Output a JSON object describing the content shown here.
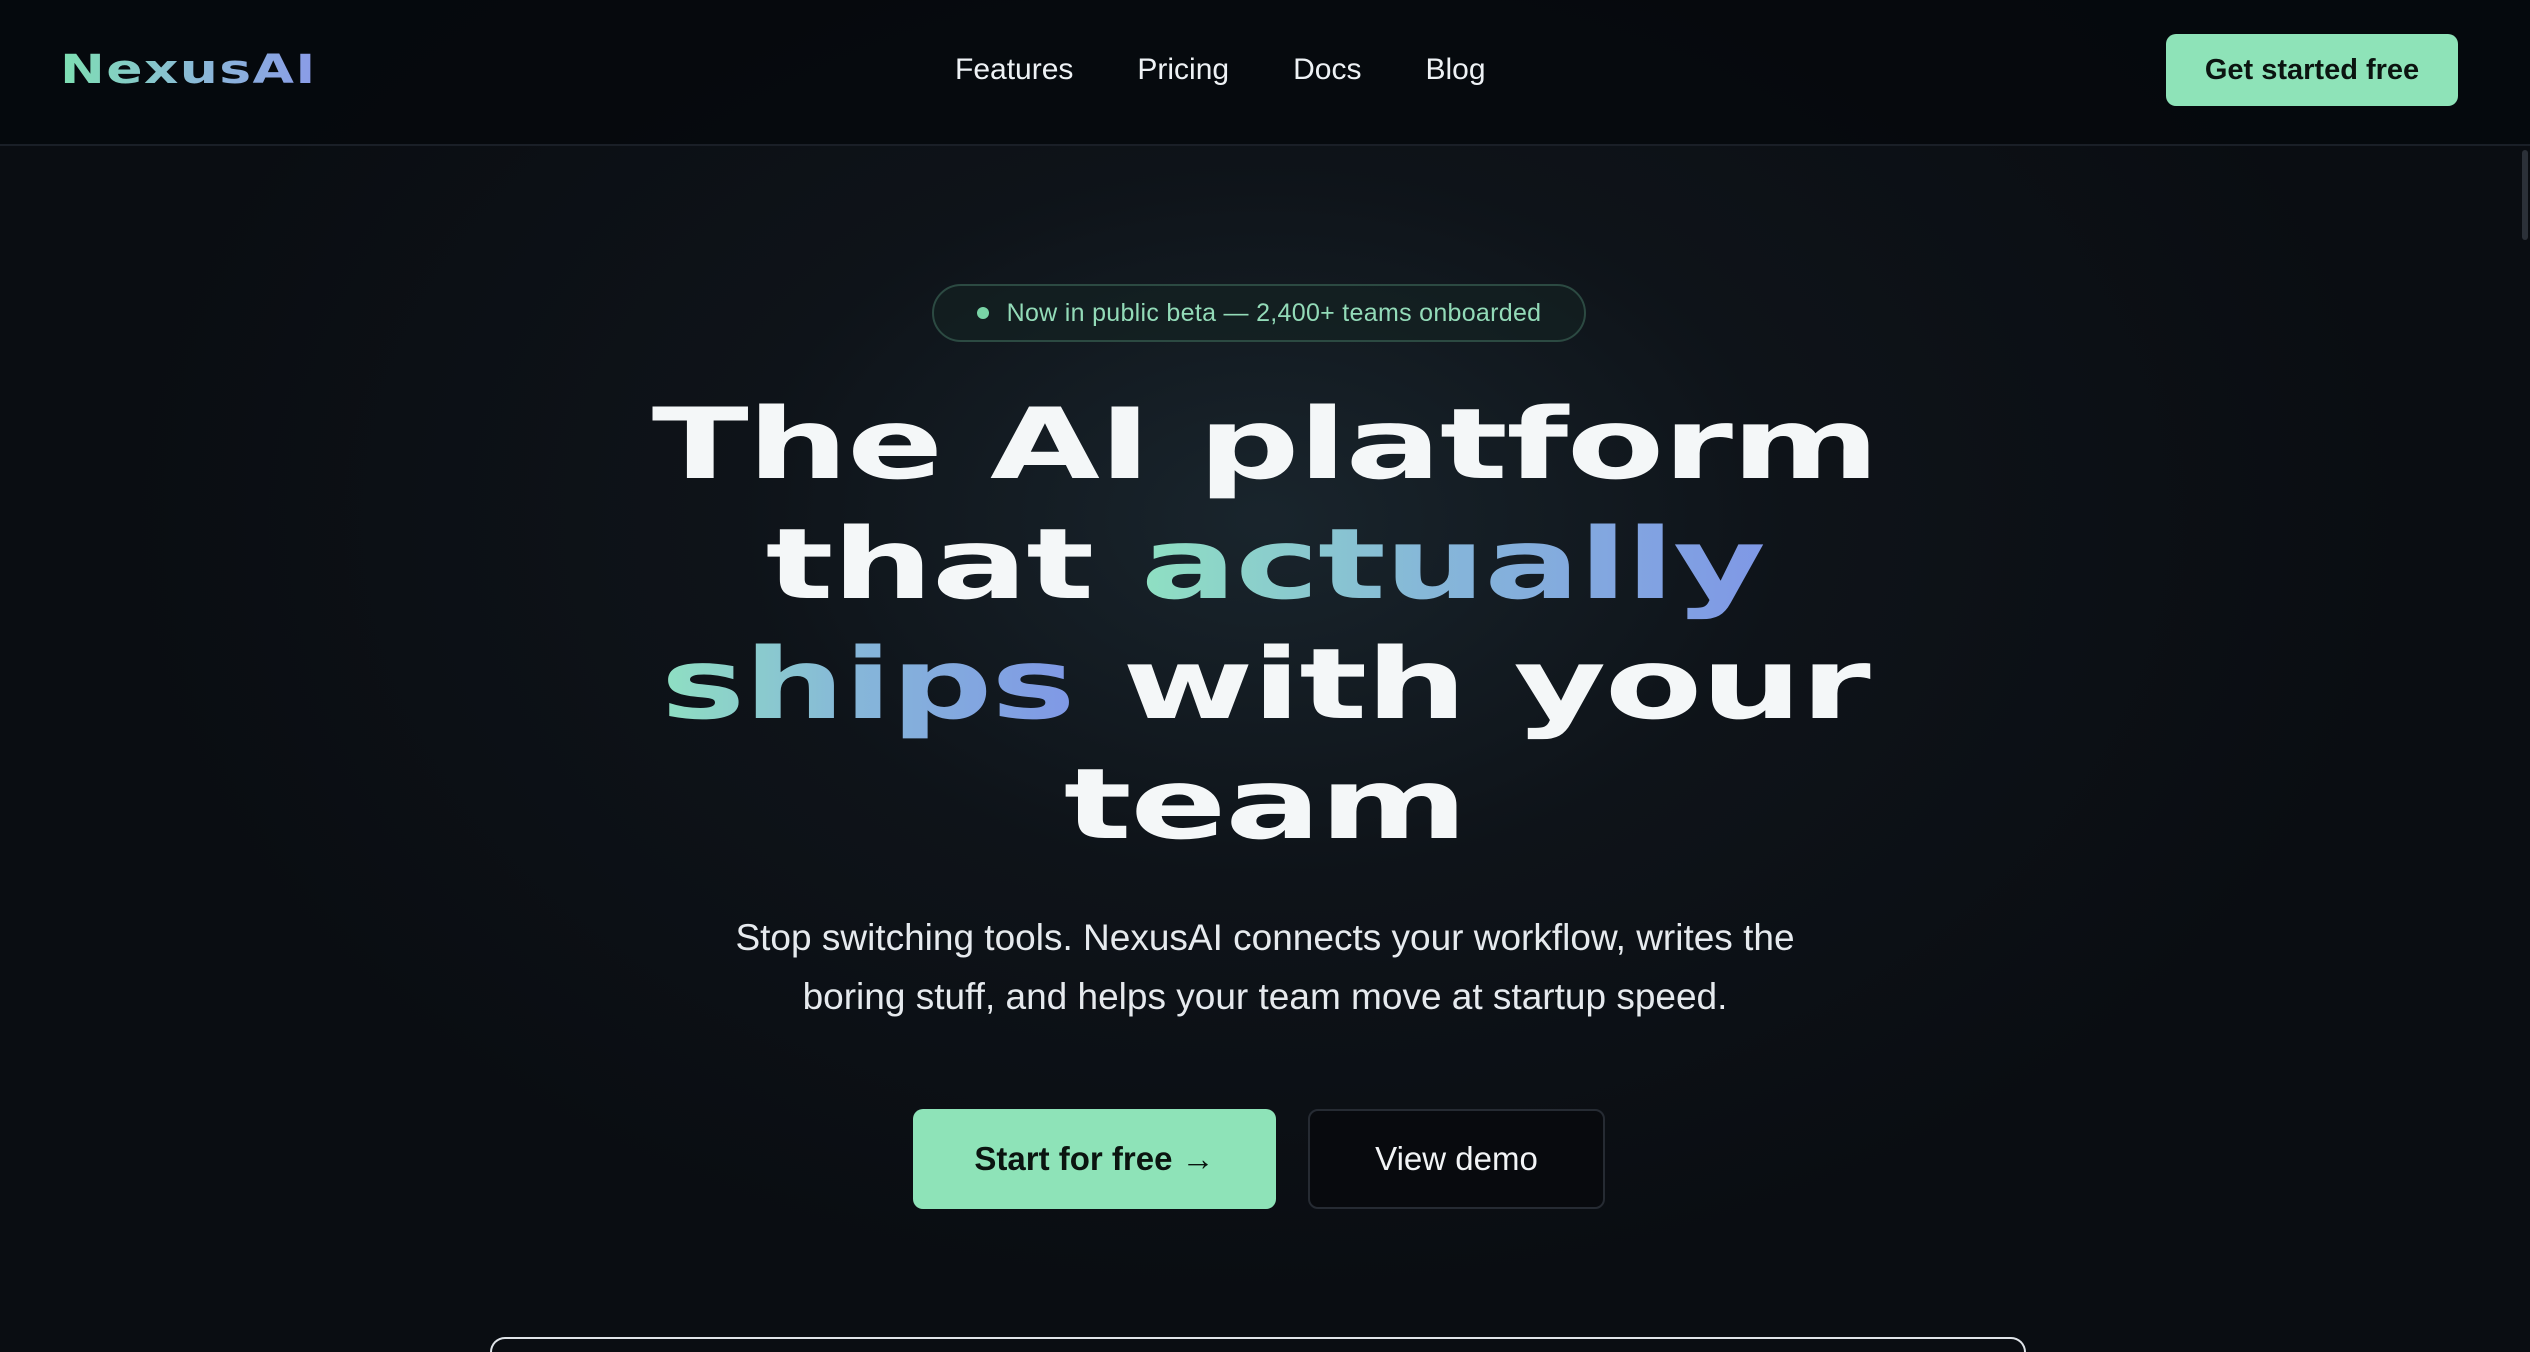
{
  "nav": {
    "logo": "NexusAI",
    "links": [
      "Features",
      "Pricing",
      "Docs",
      "Blog"
    ],
    "cta_label": "Get started free"
  },
  "hero": {
    "badge_text": "Now in public beta — 2,400+ teams onboarded",
    "headline": {
      "line1": "The AI platform",
      "line2_plain": "that ",
      "line2_highlight": "actually",
      "line3_highlight": "ships",
      "line3_plain": " with your",
      "line4": "team"
    },
    "subtext_line1": "Stop switching tools. NexusAI connects your workflow, writes the",
    "subtext_line2": "boring stuff, and helps your team move at startup speed.",
    "primary_cta": "Start for free →",
    "secondary_cta": "View demo"
  },
  "colors": {
    "accent": "#8ee3b8",
    "background": "#0a0d12",
    "gradient_start": "#8fe0c2",
    "gradient_end": "#7f98e6"
  }
}
